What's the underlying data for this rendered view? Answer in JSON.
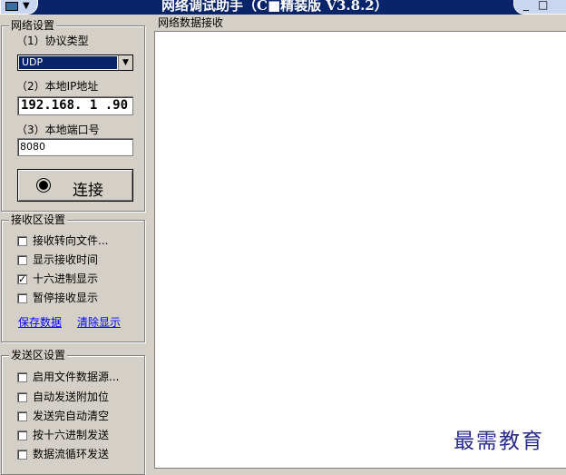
{
  "window": {
    "title": "网络调试助手（C■精装版 V3.8.2）",
    "sysmenu_arrow": "▼",
    "controls": {
      "minimize": "_",
      "maximize": "□"
    }
  },
  "network_settings": {
    "title": "网络设置",
    "protocol_label": "（1）协议类型",
    "protocol_value": "UDP",
    "ip_label": "（2）本地IP地址",
    "ip_value": "192.168. 1 .90",
    "port_label": "（3）本地端口号",
    "port_value": "8080",
    "connect_label": "连接"
  },
  "receive_settings": {
    "title": "接收区设置",
    "options": [
      {
        "label": "接收转向文件...",
        "checked": false
      },
      {
        "label": "显示接收时间",
        "checked": false
      },
      {
        "label": "十六进制显示",
        "checked": true
      },
      {
        "label": "暂停接收显示",
        "checked": false
      }
    ],
    "save_link": "保存数据",
    "clear_link": "清除显示"
  },
  "send_settings": {
    "title": "发送区设置",
    "options": [
      {
        "label": "启用文件数据源...",
        "checked": false
      },
      {
        "label": "自动发送附加位",
        "checked": false
      },
      {
        "label": "发送完自动清空",
        "checked": false
      },
      {
        "label": "按十六进制发送",
        "checked": false
      },
      {
        "label": "数据流循环发送",
        "checked": false
      }
    ]
  },
  "receive_area": {
    "title": "网络数据接收"
  },
  "watermark": "最需教育",
  "colors": {
    "titlebar": "#0a246a",
    "face": "#d4d0c8",
    "link": "#0000ff",
    "selection": "#0a246a"
  }
}
